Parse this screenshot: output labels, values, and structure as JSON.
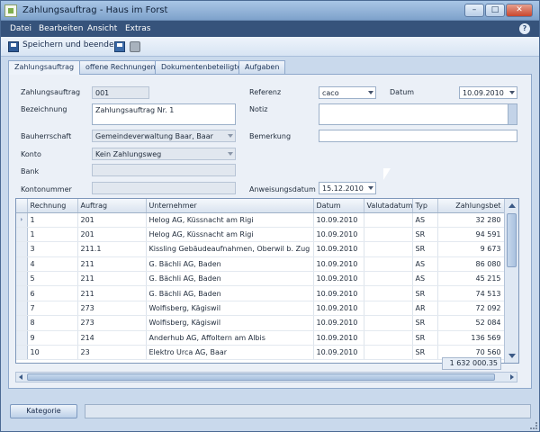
{
  "window": {
    "title": "Zahlungsauftrag - Haus im Forst"
  },
  "menu": [
    "Datei",
    "Bearbeiten",
    "Ansicht",
    "Extras"
  ],
  "toolbar": {
    "save_label": "Speichern und beenden"
  },
  "tabs": [
    "Zahlungsauftrag",
    "offene Rechnungen",
    "Dokumentenbeteiligte",
    "Aufgaben"
  ],
  "form": {
    "zahlungsauftrag_label": "Zahlungsauftrag",
    "zahlungsauftrag_value": "001",
    "bezeichnung_label": "Bezeichnung",
    "bezeichnung_value": "Zahlungsauftrag Nr. 1",
    "bauherrschaft_label": "Bauherrschaft",
    "bauherrschaft_value": "Gemeindeverwaltung Baar, Baar",
    "konto_label": "Konto",
    "konto_value": "Kein Zahlungsweg",
    "bank_label": "Bank",
    "bank_value": "",
    "kontonummer_label": "Kontonummer",
    "kontonummer_value": "",
    "referenz_label": "Referenz",
    "referenz_value": "caco",
    "datum_label": "Datum",
    "datum_value": "10.09.2010",
    "notiz_label": "Notiz",
    "notiz_value": "",
    "bemerkung_label": "Bemerkung",
    "bemerkung_value": "",
    "anweisungsdatum_label": "Anweisungsdatum",
    "anweisungsdatum_value": "15.12.2010"
  },
  "grid": {
    "columns": [
      "Rechnung",
      "Auftrag",
      "Unternehmer",
      "Datum",
      "Valutadatum",
      "Typ",
      "Zahlungsbet"
    ],
    "rows": [
      [
        "1",
        "201",
        "Helog AG, Küssnacht am Rigi",
        "10.09.2010",
        "",
        "AS",
        "32 280"
      ],
      [
        "1",
        "201",
        "Helog AG, Küssnacht am Rigi",
        "10.09.2010",
        "",
        "SR",
        "94 591"
      ],
      [
        "3",
        "211.1",
        "Kissling Gebäudeaufnahmen, Oberwil b. Zug",
        "10.09.2010",
        "",
        "SR",
        "9 673"
      ],
      [
        "4",
        "211",
        "G. Bächli AG, Baden",
        "10.09.2010",
        "",
        "AS",
        "86 080"
      ],
      [
        "5",
        "211",
        "G. Bächli AG, Baden",
        "10.09.2010",
        "",
        "AS",
        "45 215"
      ],
      [
        "6",
        "211",
        "G. Bächli AG, Baden",
        "10.09.2010",
        "",
        "SR",
        "74 513"
      ],
      [
        "7",
        "273",
        "Wolfisberg, Kägiswil",
        "10.09.2010",
        "",
        "AR",
        "72 092"
      ],
      [
        "8",
        "273",
        "Wolfisberg, Kägiswil",
        "10.09.2010",
        "",
        "SR",
        "52 084"
      ],
      [
        "9",
        "214",
        "Anderhub AG, Affoltern am Albis",
        "10.09.2010",
        "",
        "SR",
        "136 569"
      ],
      [
        "10",
        "23",
        "Elektro Urca AG, Baar",
        "10.09.2010",
        "",
        "SR",
        "70 560"
      ]
    ],
    "total": "1 632 000.35"
  },
  "footer": {
    "kategorie_label": "Kategorie"
  },
  "icons": [
    "app-icon",
    "minimize-icon",
    "maximize-icon",
    "close-icon",
    "help-icon",
    "save-close-icon",
    "save-icon",
    "print-icon",
    "row-pointer-icon"
  ]
}
